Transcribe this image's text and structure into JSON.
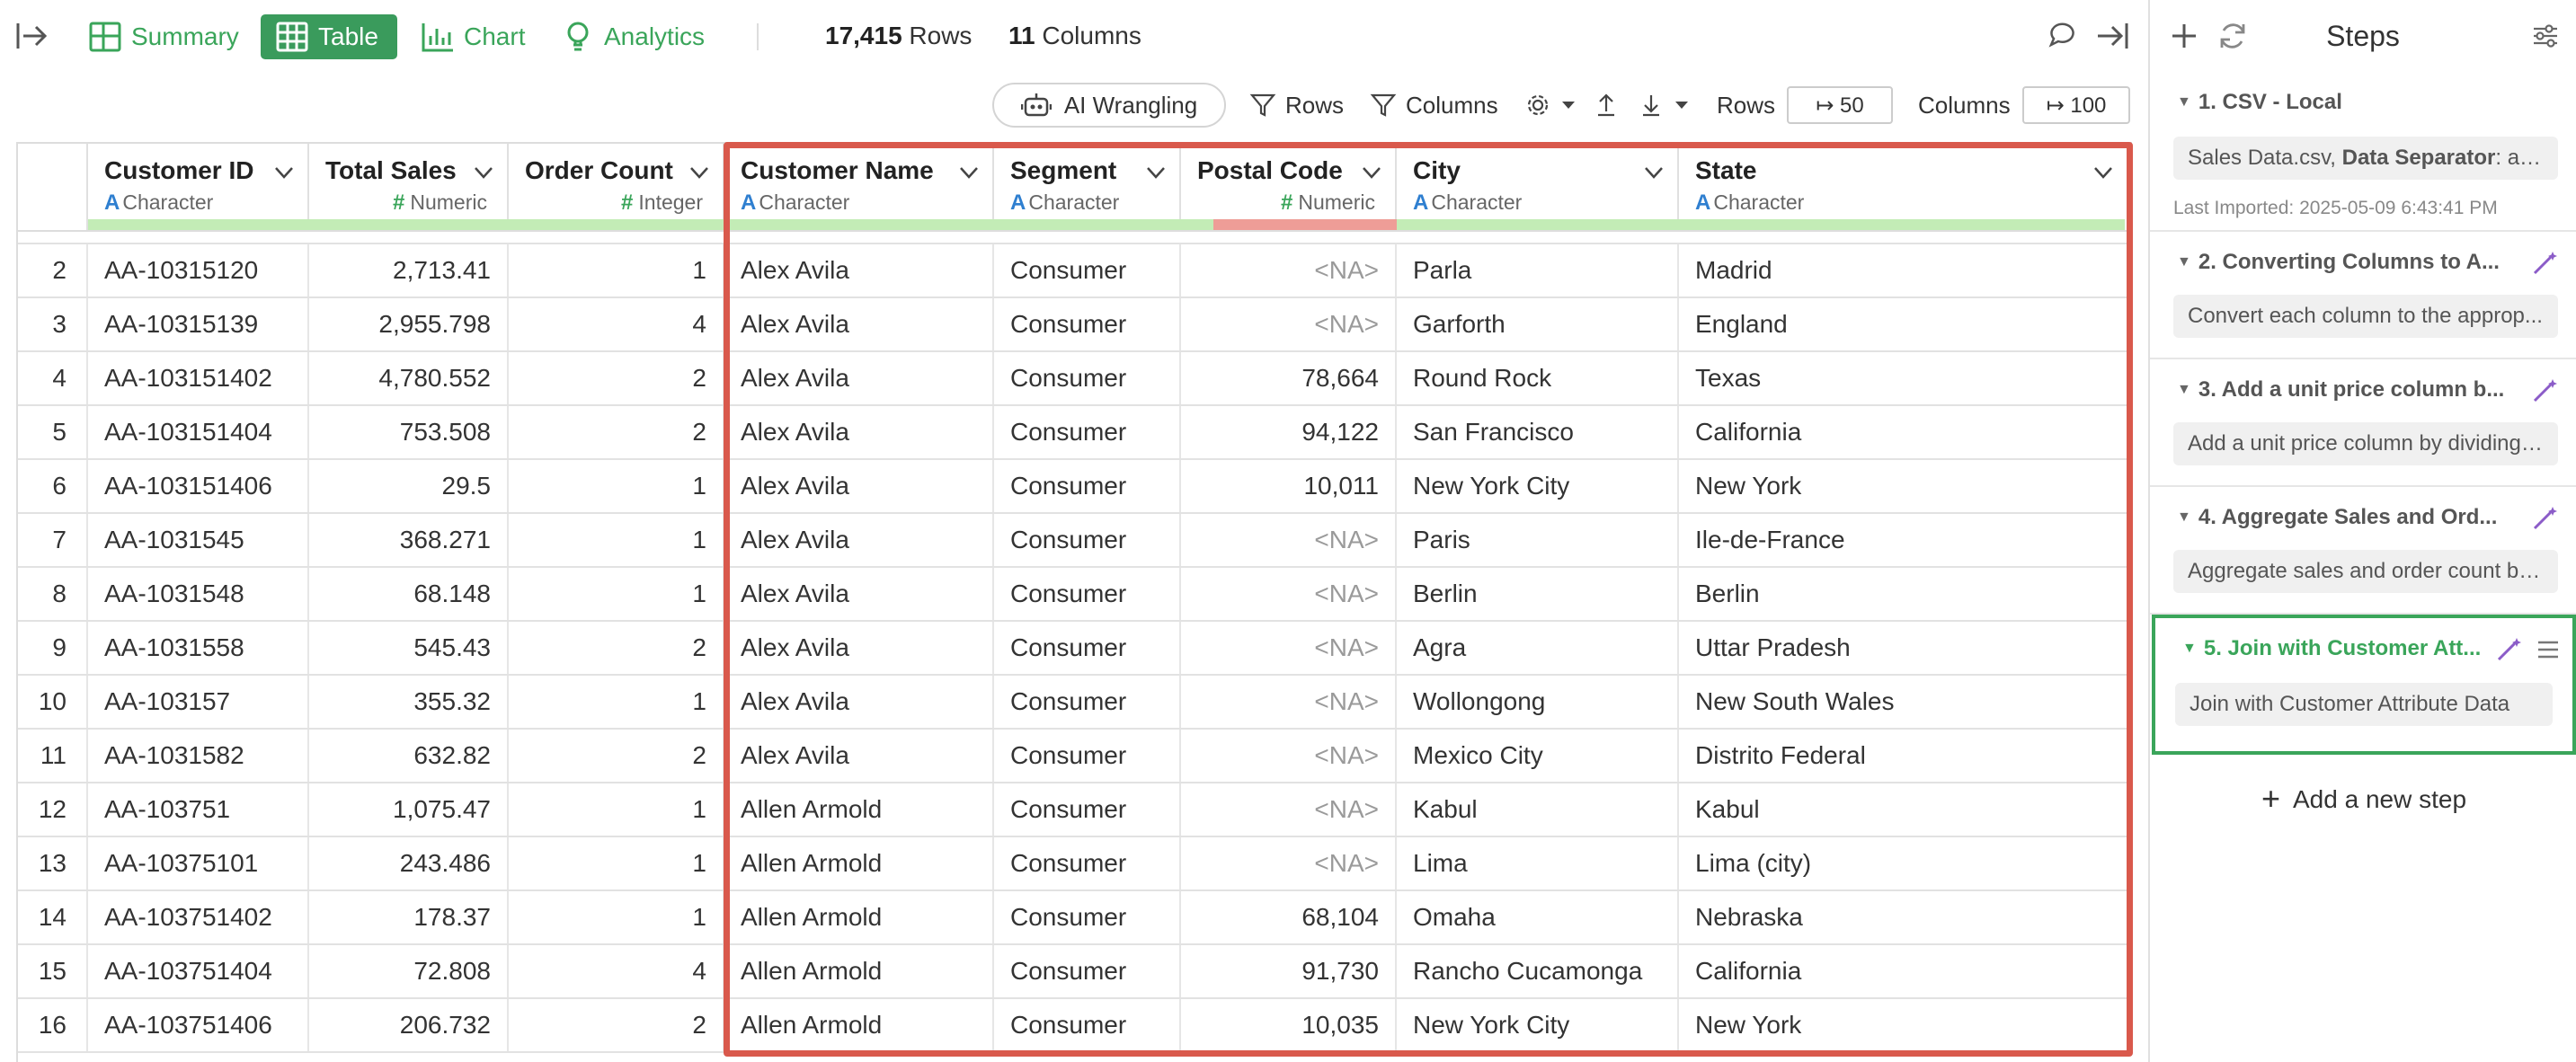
{
  "toolbar": {
    "views": [
      {
        "label": "Summary",
        "icon": "summary-icon",
        "active": false
      },
      {
        "label": "Table",
        "icon": "table-icon",
        "active": true
      },
      {
        "label": "Chart",
        "icon": "chart-icon",
        "active": false
      },
      {
        "label": "Analytics",
        "icon": "analytics-icon",
        "active": false
      }
    ],
    "rows_count": "17,415",
    "rows_label": "Rows",
    "columns_count": "11",
    "columns_label": "Columns"
  },
  "toolbar2": {
    "ai_label": "AI Wrangling",
    "rows_filter": "Rows",
    "columns_filter": "Columns",
    "rows_limit_label": "Rows",
    "rows_limit_value": "↦ 50",
    "columns_limit_label": "Columns",
    "columns_limit_value": "↦ 100"
  },
  "table": {
    "columns": [
      {
        "name": "Customer ID",
        "type": "Character",
        "type_symbol": "A"
      },
      {
        "name": "Total Sales",
        "type": "Numeric",
        "type_symbol": "#"
      },
      {
        "name": "Order Count",
        "type": "Integer",
        "type_symbol": "#"
      },
      {
        "name": "Customer Name",
        "type": "Character",
        "type_symbol": "A"
      },
      {
        "name": "Segment",
        "type": "Character",
        "type_symbol": "A"
      },
      {
        "name": "Postal Code",
        "type": "Numeric",
        "type_symbol": "#"
      },
      {
        "name": "City",
        "type": "Character",
        "type_symbol": "A"
      },
      {
        "name": "State",
        "type": "Character",
        "type_symbol": "A"
      }
    ],
    "rows": [
      [
        "2",
        "AA-10315120",
        "2,713.41",
        "1",
        "Alex Avila",
        "Consumer",
        "<NA>",
        "Parla",
        "Madrid"
      ],
      [
        "3",
        "AA-10315139",
        "2,955.798",
        "4",
        "Alex Avila",
        "Consumer",
        "<NA>",
        "Garforth",
        "England"
      ],
      [
        "4",
        "AA-103151402",
        "4,780.552",
        "2",
        "Alex Avila",
        "Consumer",
        "78,664",
        "Round Rock",
        "Texas"
      ],
      [
        "5",
        "AA-103151404",
        "753.508",
        "2",
        "Alex Avila",
        "Consumer",
        "94,122",
        "San Francisco",
        "California"
      ],
      [
        "6",
        "AA-103151406",
        "29.5",
        "1",
        "Alex Avila",
        "Consumer",
        "10,011",
        "New York City",
        "New York"
      ],
      [
        "7",
        "AA-1031545",
        "368.271",
        "1",
        "Alex Avila",
        "Consumer",
        "<NA>",
        "Paris",
        "Ile-de-France"
      ],
      [
        "8",
        "AA-1031548",
        "68.148",
        "1",
        "Alex Avila",
        "Consumer",
        "<NA>",
        "Berlin",
        "Berlin"
      ],
      [
        "9",
        "AA-1031558",
        "545.43",
        "2",
        "Alex Avila",
        "Consumer",
        "<NA>",
        "Agra",
        "Uttar Pradesh"
      ],
      [
        "10",
        "AA-103157",
        "355.32",
        "1",
        "Alex Avila",
        "Consumer",
        "<NA>",
        "Wollongong",
        "New South Wales"
      ],
      [
        "11",
        "AA-1031582",
        "632.82",
        "2",
        "Alex Avila",
        "Consumer",
        "<NA>",
        "Mexico City",
        "Distrito Federal"
      ],
      [
        "12",
        "AA-103751",
        "1,075.47",
        "1",
        "Allen Armold",
        "Consumer",
        "<NA>",
        "Kabul",
        "Kabul"
      ],
      [
        "13",
        "AA-10375101",
        "243.486",
        "1",
        "Allen Armold",
        "Consumer",
        "<NA>",
        "Lima",
        "Lima (city)"
      ],
      [
        "14",
        "AA-103751402",
        "178.37",
        "1",
        "Allen Armold",
        "Consumer",
        "68,104",
        "Omaha",
        "Nebraska"
      ],
      [
        "15",
        "AA-103751404",
        "72.808",
        "4",
        "Allen Armold",
        "Consumer",
        "91,730",
        "Rancho Cucamonga",
        "California"
      ],
      [
        "16",
        "AA-103751406",
        "206.732",
        "2",
        "Allen Armold",
        "Consumer",
        "10,035",
        "New York City",
        "New York"
      ]
    ]
  },
  "steps": {
    "title": "Steps",
    "items": [
      {
        "title": "1. CSV - Local",
        "desc_prefix": "Sales Data.csv, ",
        "desc_bold": "Data Separator",
        "desc_suffix": ": auto",
        "meta": "Last Imported: 2025-05-09 6:43:41 PM"
      },
      {
        "title": "2. Converting Columns to A...",
        "desc": "Convert each column to the approp..."
      },
      {
        "title": "3. Add a unit price column b...",
        "desc": "Add a unit price column by dividing ..."
      },
      {
        "title": "4. Aggregate Sales and Ord...",
        "desc": "Aggregate sales and order count by..."
      },
      {
        "title": "5. Join with Customer Att...",
        "desc": "Join with Customer Attribute Data"
      }
    ],
    "add_label": "Add a new step"
  },
  "colors": {
    "accent": "#3aa55a",
    "active_view": "#3a9b5c",
    "highlight": "#d9594c",
    "quality_ok": "#c3ecb6",
    "quality_bad": "#ee9d97"
  }
}
